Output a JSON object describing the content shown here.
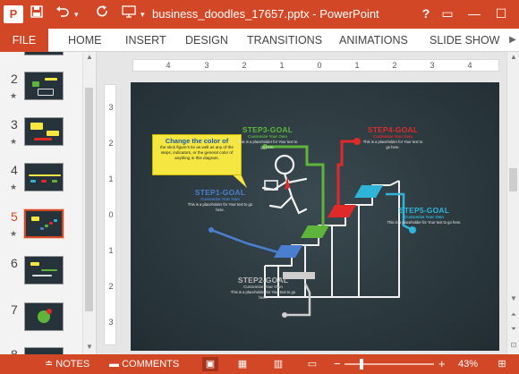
{
  "titlebar": {
    "app_logo": "P",
    "title": "business_doodles_17657.pptx - PowerPoint",
    "help": "?",
    "restore": "▭",
    "minimize": "—",
    "maximize": "☐"
  },
  "tabs": {
    "file": "FILE",
    "items": [
      "HOME",
      "INSERT",
      "DESIGN",
      "TRANSITIONS",
      "ANIMATIONS",
      "SLIDE SHOW"
    ]
  },
  "thumbnails": [
    {
      "number": "2",
      "star": "★"
    },
    {
      "number": "3",
      "star": "★"
    },
    {
      "number": "4",
      "star": "★"
    },
    {
      "number": "5",
      "star": "★"
    },
    {
      "number": "6",
      "star": ""
    },
    {
      "number": "7",
      "star": ""
    },
    {
      "number": "8",
      "star": ""
    }
  ],
  "ruler": {
    "h": [
      "4",
      "3",
      "2",
      "1",
      "0",
      "1",
      "2",
      "3",
      "4"
    ],
    "v": [
      "3",
      "2",
      "1",
      "0",
      "1",
      "2",
      "3"
    ]
  },
  "slide": {
    "callout": {
      "title": "Change the color of",
      "body": "the stick figure's tie as well as any of the steps, indicators, or the general color of anything in this diagram."
    },
    "goals": [
      {
        "title": "STEP3-GOAL",
        "sub": "Customize Your Own",
        "body": "This is a placeholder for Your text to go here.",
        "color": "#5fb53a"
      },
      {
        "title": "STEP4-GOAL",
        "sub": "Customize Your Own",
        "body": "This is a placeholder for Your text to go here.",
        "color": "#e02a2a"
      },
      {
        "title": "STEP1-GOAL",
        "sub": "Customize Your Own",
        "body": "This is a placeholder for Your text to go here.",
        "color": "#4a7fd0"
      },
      {
        "title": "STEP5-GOAL",
        "sub": "Customize Your Own",
        "body": "This is a placeholder for Your text to go here.",
        "color": "#2fb5d8"
      },
      {
        "title": "STEP2-GOAL",
        "sub": "Customize Your Own",
        "body": "This is a placeholder for Your text to go here.",
        "color": "#b7b7b7"
      }
    ]
  },
  "statusbar": {
    "notes": "NOTES",
    "comments": "COMMENTS",
    "zoom_minus": "−",
    "zoom_plus": "+",
    "zoom": "43%"
  },
  "colors": {
    "accent": "#d24726",
    "slide_bg": "#2b3a40",
    "callout": "#f5e642"
  }
}
